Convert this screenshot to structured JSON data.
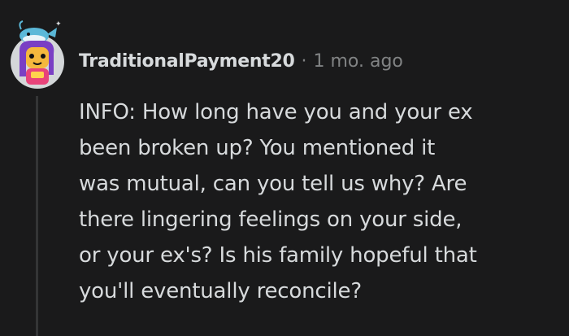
{
  "comment": {
    "username": "TraditionalPayment20",
    "separator": "·",
    "timestamp": "1 mo. ago",
    "lines": [
      "INFO: How long have you and your ex",
      "been broken up? You mentioned it",
      "was mutual, can you tell us why? Are",
      "there lingering feelings on your side,",
      "or your ex's? Is his family hopeful that",
      "you'll eventually reconcile?"
    ],
    "avatar_icon": "snoo-avatar-icon"
  },
  "colors": {
    "background": "#1a1a1b",
    "text": "#d7dadc",
    "meta": "#818384",
    "thread_line": "#343536"
  }
}
